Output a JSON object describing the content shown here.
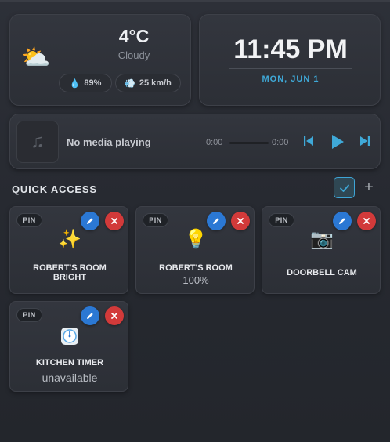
{
  "colors": {
    "accent": "#3fa9d8",
    "edit": "#2b78d4",
    "delete": "#d23a3a",
    "background": "#2a2d33"
  },
  "weather": {
    "icon": "partly-cloudy-icon",
    "temperature": "4°C",
    "condition": "Cloudy",
    "humidity": "89%",
    "wind": "25 km/h"
  },
  "clock": {
    "time": "11:45 PM",
    "date": "MON, JUN 1"
  },
  "media": {
    "title": "No media playing",
    "current_time": "0:00",
    "total_time": "0:00",
    "progress": 0
  },
  "quick_access": {
    "title": "QUICK ACCESS",
    "pin_label": "PIN",
    "tiles": [
      {
        "name": "ROBERT'S ROOM BRIGHT",
        "state": "",
        "icon": "sparkles-icon"
      },
      {
        "name": "ROBERT'S ROOM",
        "state": "100%",
        "icon": "light-bulb-icon"
      },
      {
        "name": "DOORBELL CAM",
        "state": "",
        "icon": "camera-icon"
      },
      {
        "name": "KITCHEN TIMER",
        "state": "unavailable",
        "icon": "timer-icon"
      }
    ]
  }
}
